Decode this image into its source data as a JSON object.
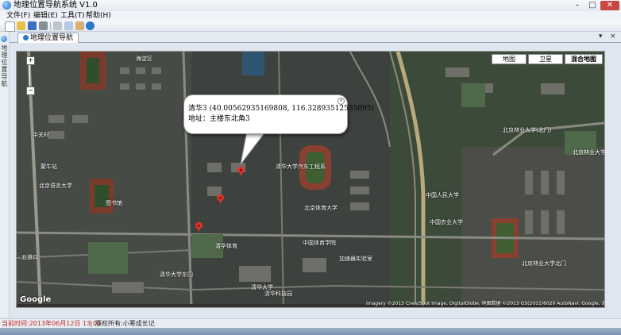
{
  "window": {
    "title": "地理位置导航系统 V1.0",
    "min": "–",
    "max": "□",
    "close": "✕"
  },
  "menu": [
    "文件(F)",
    "编辑(E)",
    "工具(T)",
    "帮助(H)"
  ],
  "toolbar": {
    "icons": [
      "new-icon",
      "open-icon",
      "save-icon",
      "print-icon",
      "cut-icon",
      "copy-icon",
      "paste-icon",
      "help-icon"
    ]
  },
  "sidebar": {
    "label": "地理位置导航"
  },
  "tab": {
    "label": "地理位置导航",
    "pin": "▾",
    "close": "×"
  },
  "map": {
    "types": [
      "地图",
      "卫星",
      "混合地图"
    ],
    "selected_type": "混合地图",
    "zoom_in": "+",
    "zoom_out": "−",
    "labels": [
      "清华大学汽车工程系",
      "中国人民大学",
      "中国农业大学",
      "北京林业大学(北门)",
      "北京林业大学",
      "图书馆",
      "北京体育大学",
      "中国体育学院",
      "清华大学东门",
      "清华大学",
      "北京林业大学北门",
      "清华体育",
      "加速器实验室",
      "中关村",
      "海淀区",
      "北京语言大学",
      "五道口",
      "蒙牛站",
      "清华科技园"
    ],
    "copyright": "Imagery ©2013 Cnes/Spot Image, DigitalGlobe, 地图数据 ©2013 GS(2011)6020 AutoNavi, Google, 北京测绘",
    "google": "Google"
  },
  "info": {
    "line1": "清华3 (40.00562935169808, 116.32893512535095)",
    "line2": "地址：主楼东北角3",
    "close": "×"
  },
  "status": {
    "time": "当前时间:2013年06月12日 13:00",
    "copyright": "版权所有:小寒成长记"
  }
}
